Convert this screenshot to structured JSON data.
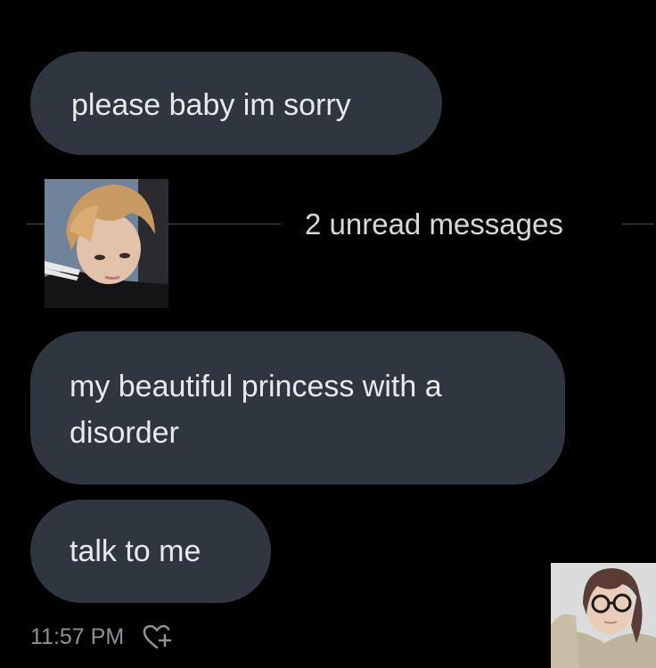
{
  "messages": [
    {
      "text": "please baby im sorry"
    },
    {
      "text": "my beautiful princess with a disorder"
    },
    {
      "text": "talk to me"
    }
  ],
  "divider": {
    "label": "2 unread messages"
  },
  "footer": {
    "timestamp": "11:57 PM",
    "react_icon": "heart-plus-icon"
  },
  "colors": {
    "background": "#000000",
    "bubble": "#2f3640",
    "text": "#e7e9ea",
    "muted": "#8b9298"
  }
}
